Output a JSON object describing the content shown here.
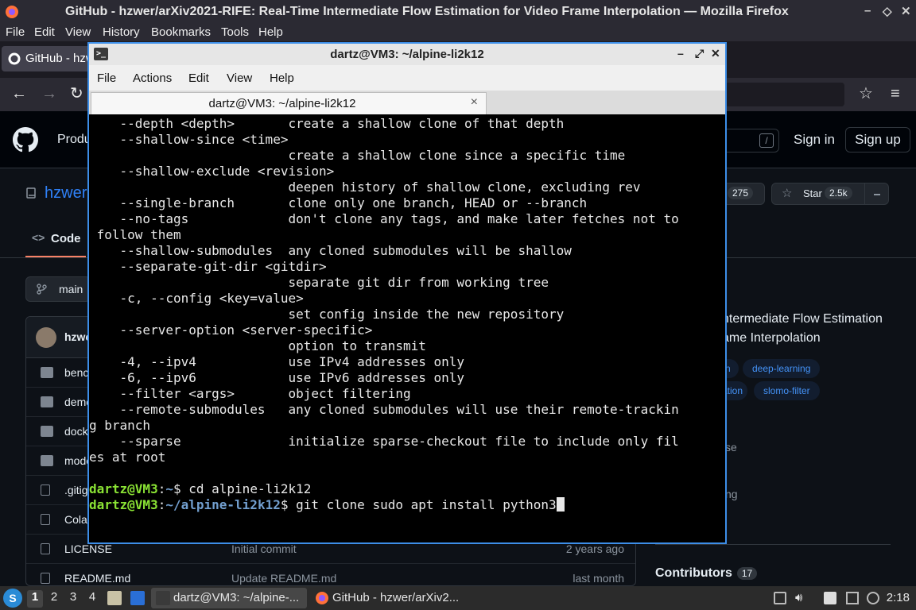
{
  "firefox": {
    "window_title": "GitHub - hzwer/arXiv2021-RIFE: Real-Time Intermediate Flow Estimation for Video Frame Interpolation — Mozilla Firefox",
    "menu": [
      "File",
      "Edit",
      "View",
      "History",
      "Bookmarks",
      "Tools",
      "Help"
    ],
    "tab_label": "GitHub - hzw"
  },
  "github": {
    "nav_partial": "Produ",
    "search_shortcut": "/",
    "sign_in": "Sign in",
    "sign_up": "Sign up",
    "repo_name_partial": "hzwer",
    "fork_count": "275",
    "star_label": "Star",
    "star_count": "2.5k",
    "code_tab": "Code",
    "branch": "main",
    "owner_partial": "hzwe",
    "files": [
      {
        "name": "benc",
        "type": "folder",
        "message": "",
        "date": ""
      },
      {
        "name": "demo",
        "type": "folder",
        "message": "",
        "date": ""
      },
      {
        "name": "dock",
        "type": "folder",
        "message": "",
        "date": ""
      },
      {
        "name": "mode",
        "type": "folder",
        "message": "",
        "date": ""
      },
      {
        "name": ".gitig",
        "type": "file",
        "message": "",
        "date": ""
      },
      {
        "name": "Cola",
        "type": "file",
        "message": "",
        "date": ""
      },
      {
        "name": "LICENSE",
        "type": "file",
        "message": "Initial commit",
        "date": "2 years ago"
      },
      {
        "name": "README.md",
        "type": "file",
        "message": "Update README.md",
        "date": "last month"
      }
    ],
    "about_desc_line1": "ntermediate Flow Estimation",
    "about_desc_line2": "ame Interpolation",
    "topics": [
      {
        "label": "n"
      },
      {
        "label": "deep-learning"
      },
      {
        "label": "ation"
      },
      {
        "label": "slomo-filter"
      }
    ],
    "about_partial_1": "se",
    "about_partial_2": "ng",
    "contributors_label": "Contributors",
    "contributors_count": "17"
  },
  "terminal": {
    "window_title": "dartz@VM3: ~/alpine-li2k12",
    "menu": [
      "File",
      "Actions",
      "Edit",
      "View",
      "Help"
    ],
    "tab_label": "dartz@VM3: ~/alpine-li2k12",
    "tab_close": "×",
    "lines": [
      "    --depth <depth>       create a shallow clone of that depth",
      "    --shallow-since <time>",
      "                          create a shallow clone since a specific time",
      "    --shallow-exclude <revision>",
      "                          deepen history of shallow clone, excluding rev",
      "    --single-branch       clone only one branch, HEAD or --branch",
      "    --no-tags             don't clone any tags, and make later fetches not to",
      " follow them",
      "    --shallow-submodules  any cloned submodules will be shallow",
      "    --separate-git-dir <gitdir>",
      "                          separate git dir from working tree",
      "    -c, --config <key=value>",
      "                          set config inside the new repository",
      "    --server-option <server-specific>",
      "                          option to transmit",
      "    -4, --ipv4            use IPv4 addresses only",
      "    -6, --ipv6            use IPv6 addresses only",
      "    --filter <args>       object filtering",
      "    --remote-submodules   any cloned submodules will use their remote-trackin",
      "g branch",
      "    --sparse              initialize sparse-checkout file to include only fil",
      "es at root",
      ""
    ],
    "prompt1": {
      "user": "dartz@VM3",
      "path": "~",
      "symbol": "$ ",
      "command": "cd alpine-li2k12"
    },
    "prompt2": {
      "user": "dartz@VM3",
      "path": "~/alpine-li2k12",
      "symbol": "$ ",
      "command": "git clone sudo apt install python3"
    }
  },
  "taskbar": {
    "workspaces": [
      "1",
      "2",
      "3",
      "4"
    ],
    "active_workspace": "1",
    "task_terminal": "dartz@VM3: ~/alpine-...",
    "task_firefox": "GitHub - hzwer/arXiv2...",
    "clock": "2:18"
  },
  "colors": {
    "accent_blue": "#3d8ee8",
    "prompt_user": "#8ae234",
    "prompt_path": "#729fcf",
    "github_link": "#2f81f7"
  }
}
